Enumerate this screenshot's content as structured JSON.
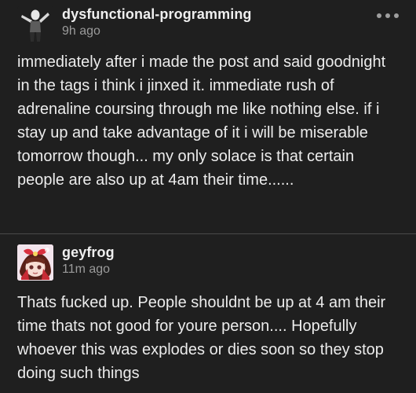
{
  "posts": [
    {
      "username": "dysfunctional-programming",
      "time": "9h ago",
      "avatar_icon": "person-standing-avatar-icon",
      "more_icon": "more-options-icon",
      "body": "immediately after i made the post and said goodnight in the tags i think i jinxed it. immediate rush of adrenaline coursing through me like nothing else. if i stay up and take advantage of it i will be miserable tomorrow though... my only solace is that certain people are also up at 4am their time......"
    },
    {
      "username": "geyfrog",
      "time": "11m ago",
      "avatar_icon": "anime-character-avatar-icon",
      "body": "Thats fucked up. People shouldnt be up at 4 am their time thats not good for youre person.... Hopefully whoever this was explodes or dies soon so they stop doing such things"
    }
  ],
  "colors": {
    "background": "#1f1f1f",
    "text": "#ededed",
    "muted": "#9b9b9b",
    "divider": "#4a4a4a"
  }
}
